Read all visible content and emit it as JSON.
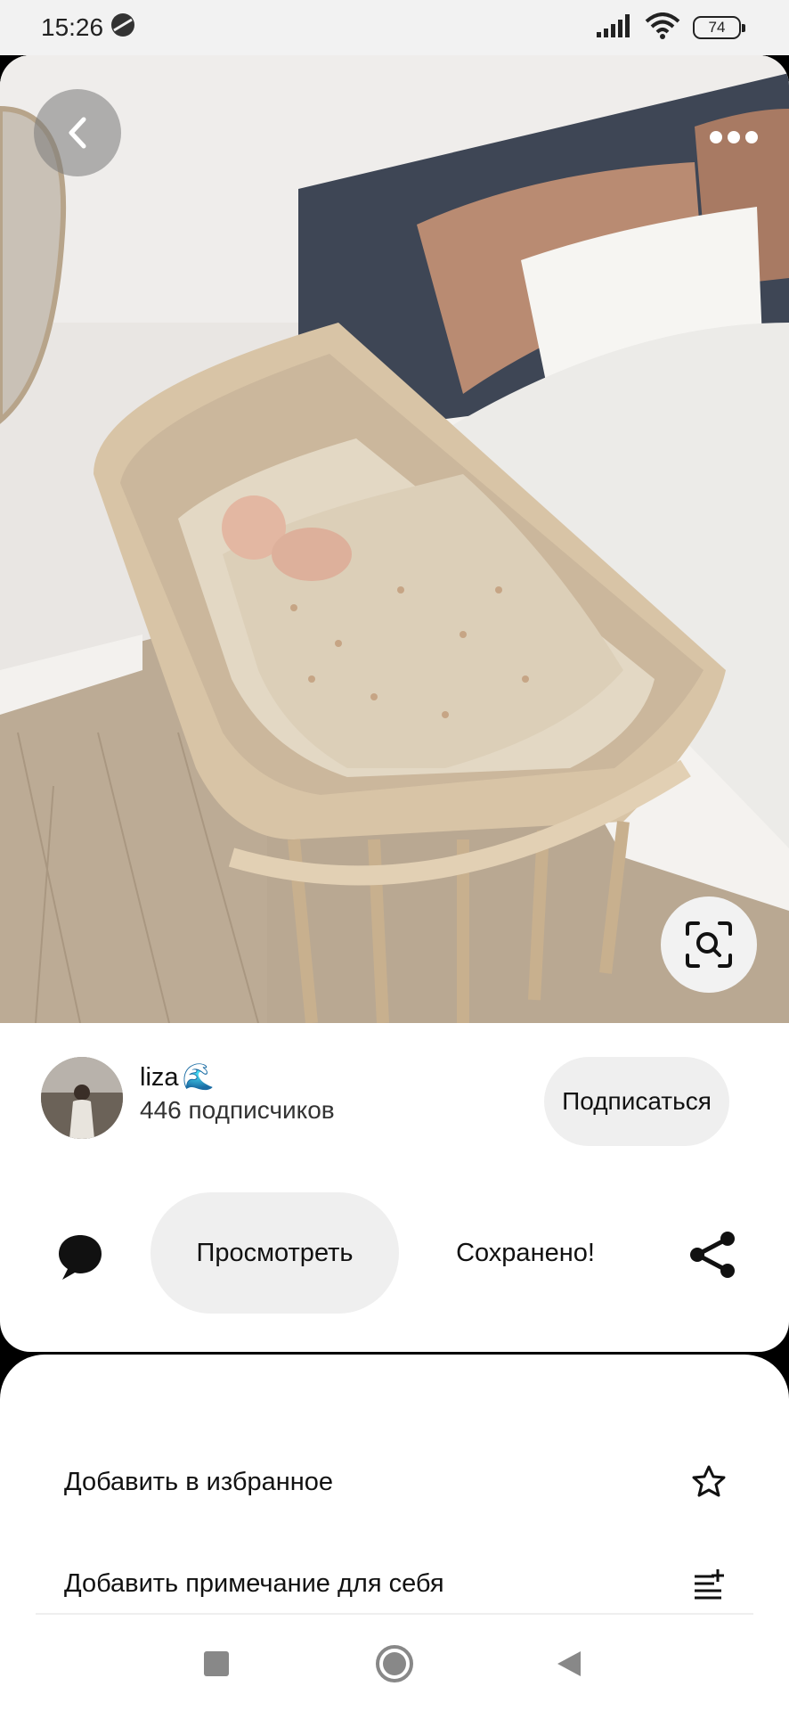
{
  "status_bar": {
    "time": "15:26",
    "battery": "74"
  },
  "pin": {
    "back_icon": "chevron-left-icon",
    "more_icon": "more-horizontal-icon",
    "visual_search_icon": "lens-search-icon",
    "image_description": "wooden bedside bassinet"
  },
  "author": {
    "name": "liza",
    "name_emoji": "🌊",
    "followers": "446 подписчиков",
    "follow_label": "Подписаться"
  },
  "actions": {
    "comment_icon": "comment-bubble-icon",
    "view_label": "Просмотреть",
    "saved_label": "Сохранено!",
    "share_icon": "share-icon"
  },
  "sheet": {
    "items": [
      {
        "label": "Добавить в избранное",
        "icon": "star-icon"
      },
      {
        "label": "Добавить примечание для себя",
        "icon": "note-add-icon"
      }
    ]
  },
  "nav": {
    "recent_icon": "square-icon",
    "home_icon": "circle-icon",
    "back_icon": "triangle-back-icon"
  }
}
